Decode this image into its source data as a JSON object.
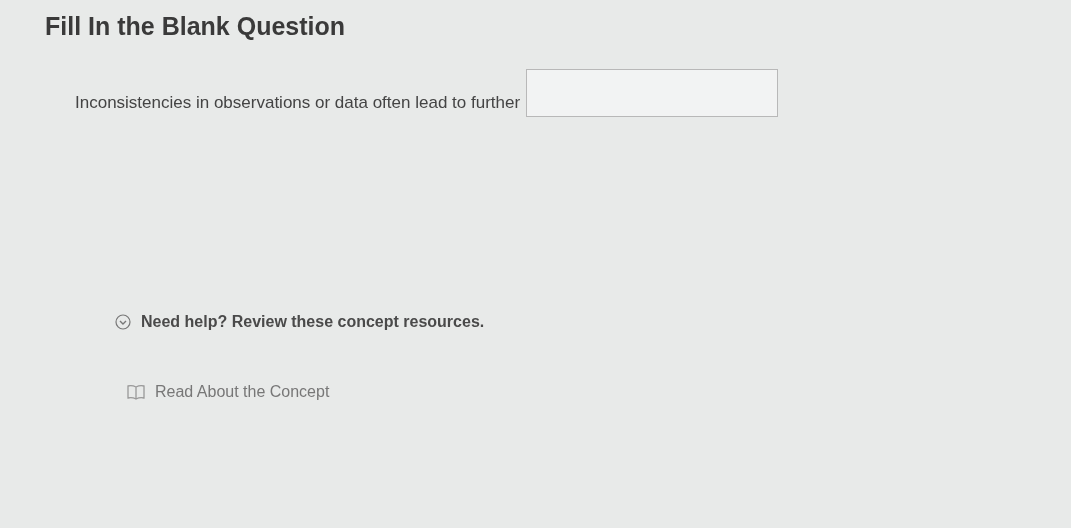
{
  "title": "Fill In the Blank Question",
  "question": {
    "text": "Inconsistencies in observations or data often lead to further"
  },
  "help": {
    "heading": "Need help? Review these concept resources.",
    "expanded": true,
    "resources": [
      {
        "label": "Read About the Concept"
      }
    ]
  }
}
